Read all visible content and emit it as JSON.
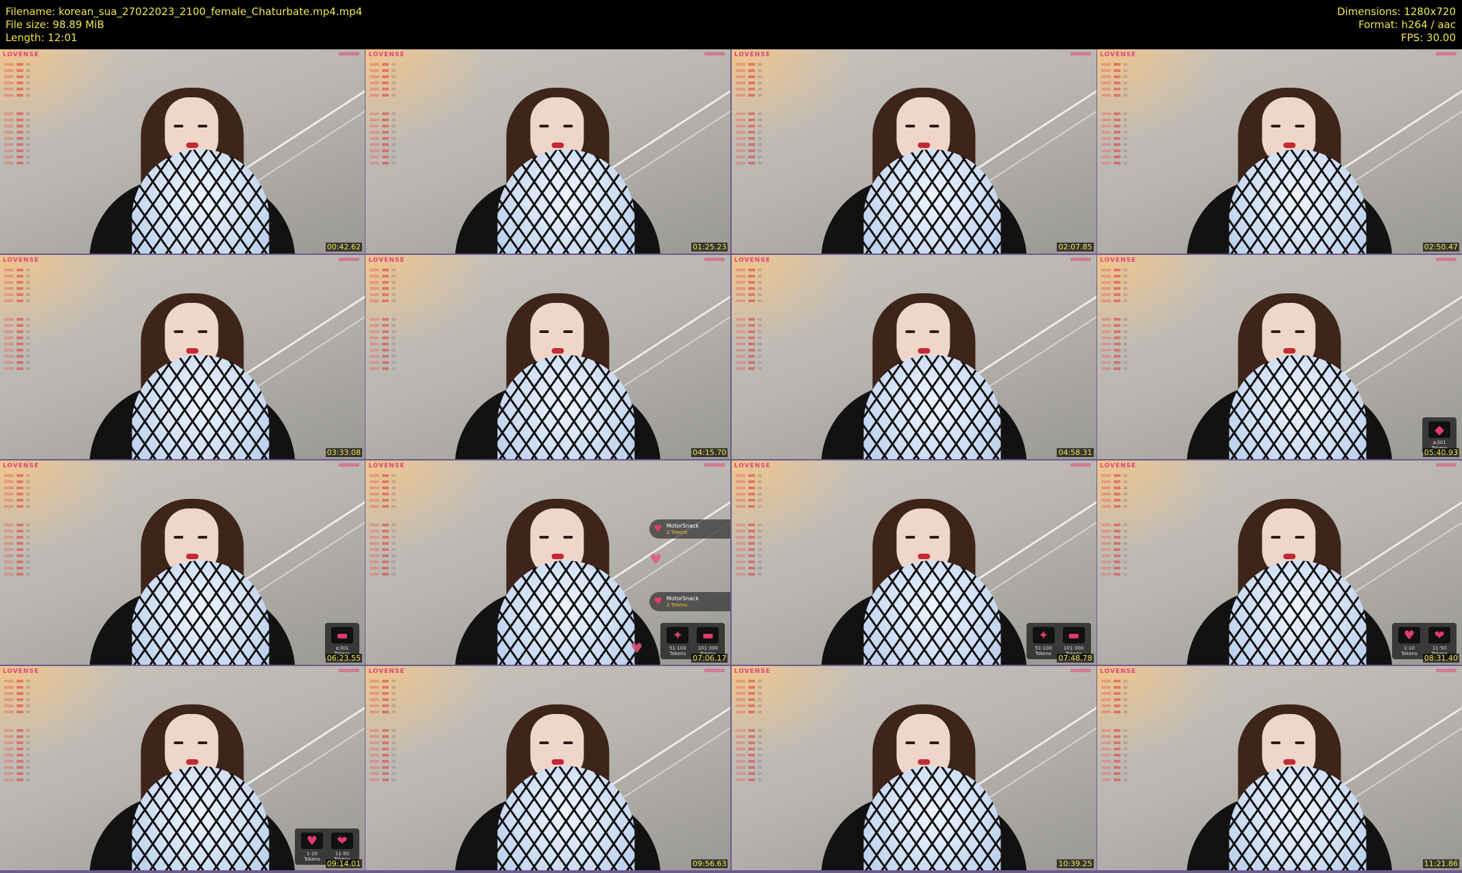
{
  "header": {
    "filename": "Filename: korean_sua_27022023_2100_female_Chaturbate.mp4.mp4",
    "filesize": "File size: 98.89 MiB",
    "length": "Length: 12:01",
    "dimensions": "Dimensions: 1280x720",
    "format": "Format: h264 / aac",
    "fps": "FPS: 30.00"
  },
  "brand": "LOVENSE",
  "tiles": [
    {
      "ts": "00:42.62"
    },
    {
      "ts": "01:25.23"
    },
    {
      "ts": "02:07.85"
    },
    {
      "ts": "02:50.47"
    },
    {
      "ts": "03:33.08"
    },
    {
      "ts": "04:15.70"
    },
    {
      "ts": "04:58.31"
    },
    {
      "ts": "05:40.93",
      "tip": [
        {
          "label": "≥301 Tokens",
          "icon": "◆"
        }
      ]
    },
    {
      "ts": "06:23.55",
      "tip": [
        {
          "label": "≥301 Tokens",
          "icon": "▬"
        }
      ]
    },
    {
      "ts": "07:06.17",
      "toasts": [
        {
          "user": "MotorSnack",
          "tokens": "2 Tokens"
        },
        {
          "user": "MotorSnack",
          "tokens": "2 Tokens"
        }
      ],
      "tip": [
        {
          "label": "51-100 Tokens",
          "icon": "✦"
        },
        {
          "label": "101-300 Tokens",
          "icon": "▬"
        }
      ]
    },
    {
      "ts": "07:48.78",
      "tip": [
        {
          "label": "51-100 Tokens",
          "icon": "✦"
        },
        {
          "label": "101-300 Tokens",
          "icon": "▬"
        }
      ]
    },
    {
      "ts": "08:31.40",
      "tip": [
        {
          "label": "1-10 Tokens",
          "icon": "♥"
        },
        {
          "label": "11-50 Tokens",
          "icon": "❤"
        }
      ]
    },
    {
      "ts": "09:14.01",
      "tip": [
        {
          "label": "1-10 Tokens",
          "icon": "♥"
        },
        {
          "label": "11-50 Tokens",
          "icon": "❤"
        }
      ]
    },
    {
      "ts": "09:56.63"
    },
    {
      "ts": "10:39.25"
    },
    {
      "ts": "11:21.86"
    }
  ]
}
